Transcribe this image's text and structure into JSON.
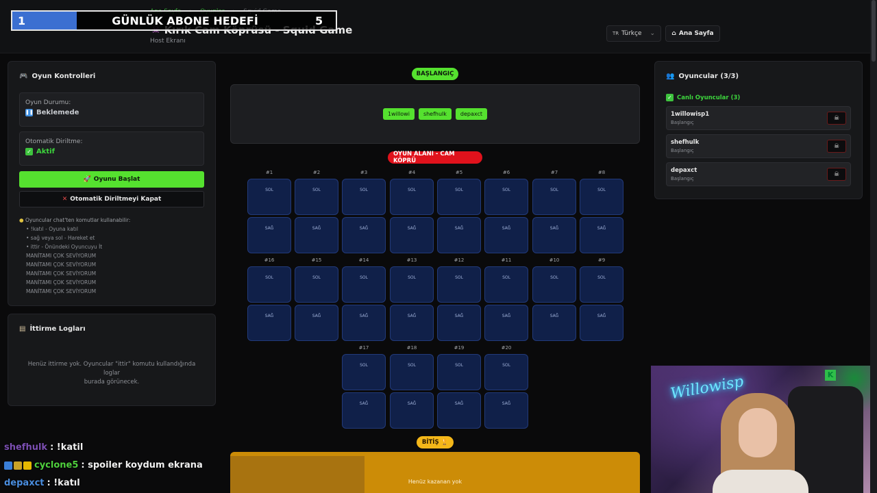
{
  "header": {
    "breadcrumb": [
      "Ana Sayfa",
      "Oyunlar",
      "Squid Game"
    ],
    "title": "Kırık Cam Köprüsü - Squid Game",
    "subtitle": "Host Ekranı",
    "language": "Türkçe",
    "language_flag": "TR",
    "home_button": "Ana Sayfa"
  },
  "goal_overlay": {
    "current": "1",
    "title": "GÜNLÜK ABONE HEDEFİ",
    "target": "5",
    "progress": 0.2
  },
  "controls": {
    "title": "Oyun Kontrolleri",
    "status_label": "Oyun Durumu:",
    "status_value": "Beklemede",
    "auto_label": "Otomatik Diriltme:",
    "auto_value": "Aktif",
    "start_button": "Oyunu Başlat",
    "disable_auto_button": "Otomatik Diriltmeyi Kapat",
    "help_head": "Oyuncular chat'ten komutlar kullanabilir:",
    "help_items": [
      "• !katıl - Oyuna katıl",
      "• sağ veya sol - Hareket et",
      "• ittir - Önündeki Oyuncuyu İt",
      "MANİTAMI ÇOK SEVİYORUM",
      "MANİTAMI ÇOK SEVİYORUM",
      "MANİTAMI ÇOK SEVİYORUM",
      "MANİTAMI ÇOK SEVİYORUM",
      "MANİTAMI ÇOK SEVİYORUM"
    ]
  },
  "logs": {
    "title": "İttirme Logları",
    "empty_line1": "Henüz ittirme yok. Oyuncular \"ittir\" komutu kullandığında loglar",
    "empty_line2": "burada görünecek."
  },
  "board": {
    "start_pill": "BAŞLANGIÇ",
    "start_players": [
      "1willowi",
      "shefhulk",
      "depaxct"
    ],
    "area_pill": "OYUN ALANI - CAM KÖPRÜ",
    "left_text": "SOL",
    "right_text": "SAĞ",
    "row1": [
      "#1",
      "#2",
      "#3",
      "#4",
      "#5",
      "#6",
      "#7",
      "#8"
    ],
    "row2": [
      "#16",
      "#15",
      "#14",
      "#13",
      "#12",
      "#11",
      "#10",
      "#9"
    ],
    "row3": [
      "#17",
      "#18",
      "#19",
      "#20"
    ],
    "end_pill": "BİTİŞ",
    "end_text": "Henüz kazanan yok"
  },
  "players": {
    "title": "Oyuncular (3/3)",
    "live_head": "Canlı Oyuncular (3)",
    "list": [
      {
        "name": "1willowisp1",
        "status": "Başlangıç"
      },
      {
        "name": "shefhulk",
        "status": "Başlangıç"
      },
      {
        "name": "depaxct",
        "status": "Başlangıç"
      }
    ]
  },
  "chat": [
    {
      "user": "shefhulk",
      "msg": ": !katil"
    },
    {
      "user": "cyclone5",
      "msg": ": spoiler koydum ekrana"
    },
    {
      "user": "depaxct",
      "msg": ": !katıl"
    }
  ],
  "webcam": {
    "neon_text": "Willowisp"
  }
}
